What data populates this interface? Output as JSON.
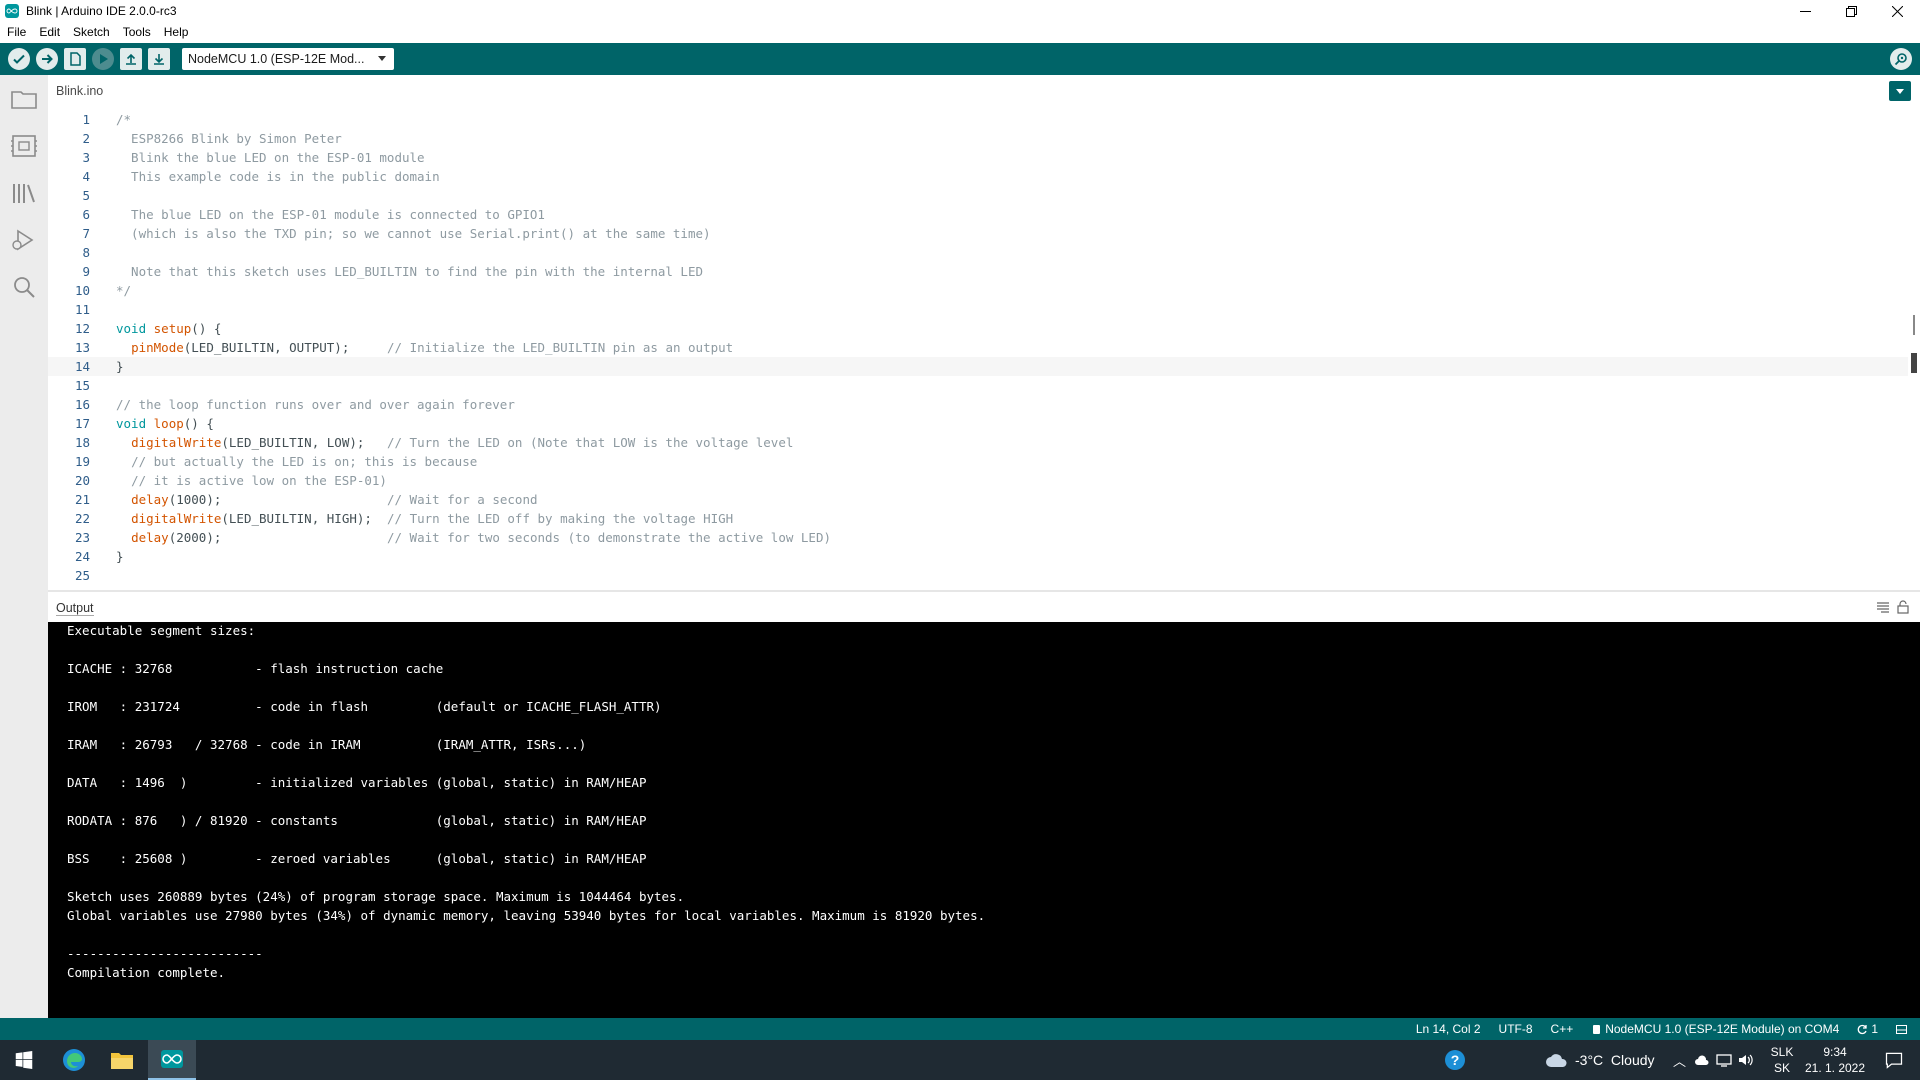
{
  "window": {
    "title": "Blink | Arduino IDE 2.0.0-rc3",
    "controls": [
      "minimize-icon",
      "restore-icon",
      "close-icon"
    ]
  },
  "menu": [
    "File",
    "Edit",
    "Sketch",
    "Tools",
    "Help"
  ],
  "toolbar": {
    "buttons": [
      "verify-icon",
      "upload-icon",
      "new-sketch-icon",
      "debug-icon",
      "open-icon",
      "save-icon"
    ],
    "board_select": "NodeMCU 1.0 (ESP-12E Mod...",
    "serial_monitor_icon": "serial-monitor-icon"
  },
  "sidebar": [
    "sketchbook-icon",
    "boards-manager-icon",
    "library-manager-icon",
    "debug-icon",
    "search-icon"
  ],
  "editor": {
    "tab": "Blink.ino",
    "current_line": 14,
    "lines": [
      "/*",
      "  ESP8266 Blink by Simon Peter",
      "  Blink the blue LED on the ESP-01 module",
      "  This example code is in the public domain",
      "",
      "  The blue LED on the ESP-01 module is connected to GPIO1",
      "  (which is also the TXD pin; so we cannot use Serial.print() at the same time)",
      "",
      "  Note that this sketch uses LED_BUILTIN to find the pin with the internal LED",
      "*/",
      "",
      "void setup() {",
      "  pinMode(LED_BUILTIN, OUTPUT);     // Initialize the LED_BUILTIN pin as an output",
      "}",
      "",
      "// the loop function runs over and over again forever",
      "void loop() {",
      "  digitalWrite(LED_BUILTIN, LOW);   // Turn the LED on (Note that LOW is the voltage level",
      "  // but actually the LED is on; this is because",
      "  // it is active low on the ESP-01)",
      "  delay(1000);                      // Wait for a second",
      "  digitalWrite(LED_BUILTIN, HIGH);  // Turn the LED off by making the voltage HIGH",
      "  delay(2000);                      // Wait for two seconds (to demonstrate the active low LED)",
      "}",
      ""
    ]
  },
  "output": {
    "title": "Output",
    "lines": [
      "Executable segment sizes:",
      "",
      "ICACHE : 32768           - flash instruction cache",
      "",
      "IROM   : 231724          - code in flash         (default or ICACHE_FLASH_ATTR)",
      "",
      "IRAM   : 26793   / 32768 - code in IRAM          (IRAM_ATTR, ISRs...)",
      "",
      "DATA   : 1496  )         - initialized variables (global, static) in RAM/HEAP",
      "",
      "RODATA : 876   ) / 81920 - constants             (global, static) in RAM/HEAP",
      "",
      "BSS    : 25608 )         - zeroed variables      (global, static) in RAM/HEAP",
      "",
      "Sketch uses 260889 bytes (24%) of program storage space. Maximum is 1044464 bytes.",
      "Global variables use 27980 bytes (34%) of dynamic memory, leaving 53940 bytes for local variables. Maximum is 81920 bytes.",
      "",
      "--------------------------",
      "Compilation complete."
    ]
  },
  "statusbar": {
    "position": "Ln 14, Col 2",
    "encoding": "UTF-8",
    "language": "C++",
    "board": "NodeMCU 1.0 (ESP-12E Module) on COM4",
    "notifications": "1"
  },
  "taskbar": {
    "apps": [
      "windows-start-icon",
      "edge-browser-icon",
      "file-explorer-icon",
      "arduino-ide-icon"
    ],
    "weather": "-3°C  Cloudy",
    "lang_line1": "SLK",
    "lang_line2": "SK",
    "time": "9:34",
    "date": "21. 1. 2022"
  },
  "colors": {
    "accent": "#006468",
    "keyword": "#00979d",
    "function": "#d35400",
    "comment": "#8e9aa1",
    "output_bg": "#000000"
  }
}
